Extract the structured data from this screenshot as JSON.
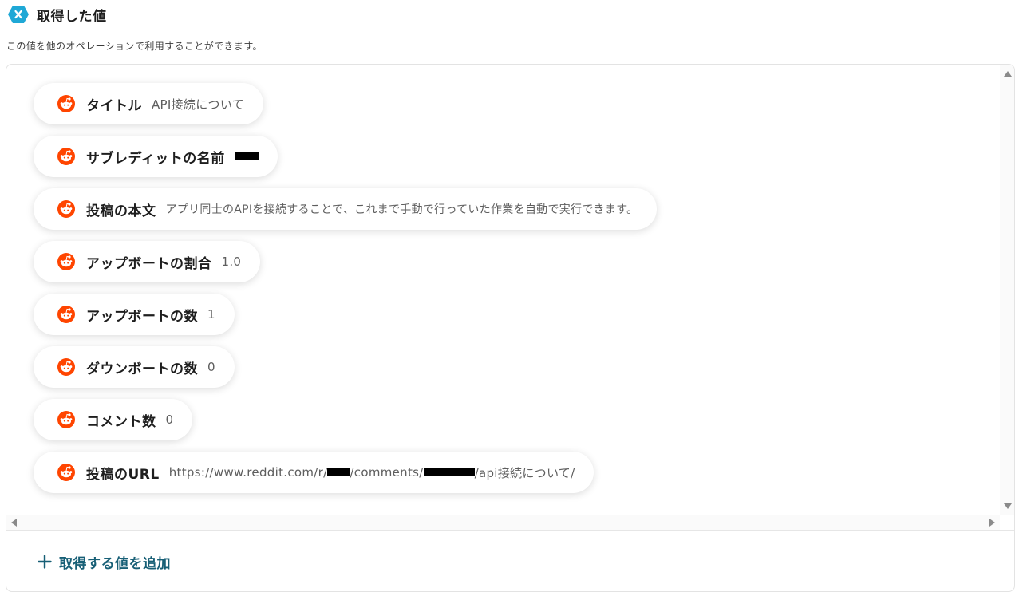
{
  "header": {
    "title": "取得した値",
    "subtitle": "この値を他のオペレーションで利用することができます。",
    "icon": "variable-x-icon",
    "icon_color": "#1fa8d6"
  },
  "items": [
    {
      "label": "タイトル",
      "value": "API接続について"
    },
    {
      "label": "サブレディットの名前",
      "value": ""
    },
    {
      "label": "投稿の本文",
      "value": "アプリ同士のAPIを接続することで、これまで手動で行っていた作業を自動で実行できます。"
    },
    {
      "label": "アップボートの割合",
      "value": "1.0"
    },
    {
      "label": "アップボートの数",
      "value": "1"
    },
    {
      "label": "ダウンボートの数",
      "value": "0"
    },
    {
      "label": "コメント数",
      "value": "0"
    },
    {
      "label": "投稿のURL",
      "value_parts": [
        "https://www.reddit.com/r/",
        "/comments/",
        "/api接続について/"
      ]
    }
  ],
  "item_icon": "reddit-icon",
  "reddit_color": "#ff4500",
  "footer": {
    "add_label": "取得する値を追加",
    "add_icon": "plus-icon",
    "accent_color": "#175f76"
  }
}
